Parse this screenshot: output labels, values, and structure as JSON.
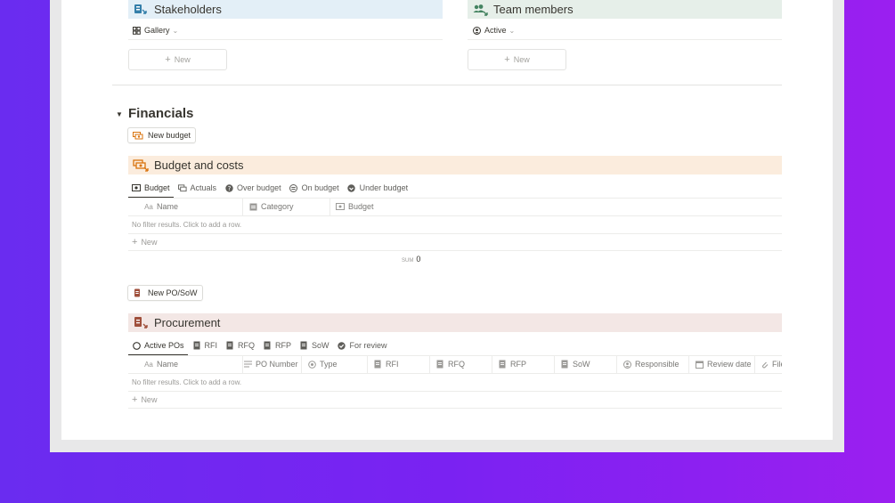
{
  "colors": {
    "background_left": "#6a2cf0",
    "background_right": "#9b1ff0",
    "stakeholders_bg": "#e3eff7",
    "team_bg": "#e6efe9",
    "budget_bg": "#fbecdd",
    "procurement_bg": "#f3e7e5",
    "budget_icon": "#d9730d",
    "procurement_icon": "#9f4f3b",
    "stakeholders_icon": "#337ea9",
    "team_icon": "#448361"
  },
  "stakeholders": {
    "title": "Stakeholders",
    "icon": "stakeholders-icon",
    "view": "Gallery",
    "new_label": "New"
  },
  "team": {
    "title": "Team members",
    "icon": "team-icon",
    "view": "Active",
    "new_label": "New"
  },
  "financials": {
    "title": "Financials",
    "new_budget_label": "New budget",
    "budget": {
      "title": "Budget and costs",
      "tabs": [
        {
          "label": "Budget",
          "icon": "money-icon"
        },
        {
          "label": "Actuals",
          "icon": "money-stack-icon"
        },
        {
          "label": "Over budget",
          "icon": "help-circle-icon"
        },
        {
          "label": "On budget",
          "icon": "equal-circle-icon"
        },
        {
          "label": "Under budget",
          "icon": "down-circle-icon"
        }
      ],
      "columns": [
        {
          "label": "Name",
          "icon": "text-icon"
        },
        {
          "label": "Category",
          "icon": "select-icon"
        },
        {
          "label": "Budget",
          "icon": "money-icon"
        }
      ],
      "empty_text": "No filter results. Click to add a row.",
      "new_label": "New",
      "sum_label": "SUM",
      "sum_value": "0"
    },
    "new_po_label": "New PO/SoW",
    "procurement": {
      "title": "Procurement",
      "tabs": [
        {
          "label": "Active POs",
          "icon": "circle-icon"
        },
        {
          "label": "RFI",
          "icon": "doc-icon"
        },
        {
          "label": "RFQ",
          "icon": "doc-icon"
        },
        {
          "label": "RFP",
          "icon": "doc-icon"
        },
        {
          "label": "SoW",
          "icon": "doc-icon"
        },
        {
          "label": "For review",
          "icon": "check-circle-icon"
        }
      ],
      "columns": [
        {
          "label": "Name",
          "icon": "text-icon"
        },
        {
          "label": "PO Number",
          "icon": "lines-icon"
        },
        {
          "label": "Type",
          "icon": "status-icon"
        },
        {
          "label": "RFI",
          "icon": "doc-icon"
        },
        {
          "label": "RFQ",
          "icon": "doc-icon"
        },
        {
          "label": "RFP",
          "icon": "doc-icon"
        },
        {
          "label": "SoW",
          "icon": "doc-icon"
        },
        {
          "label": "Responsible",
          "icon": "person-icon"
        },
        {
          "label": "Review date",
          "icon": "calendar-icon"
        },
        {
          "label": "File",
          "icon": "paperclip-icon"
        }
      ],
      "empty_text": "No filter results. Click to add a row.",
      "new_label": "New"
    }
  }
}
